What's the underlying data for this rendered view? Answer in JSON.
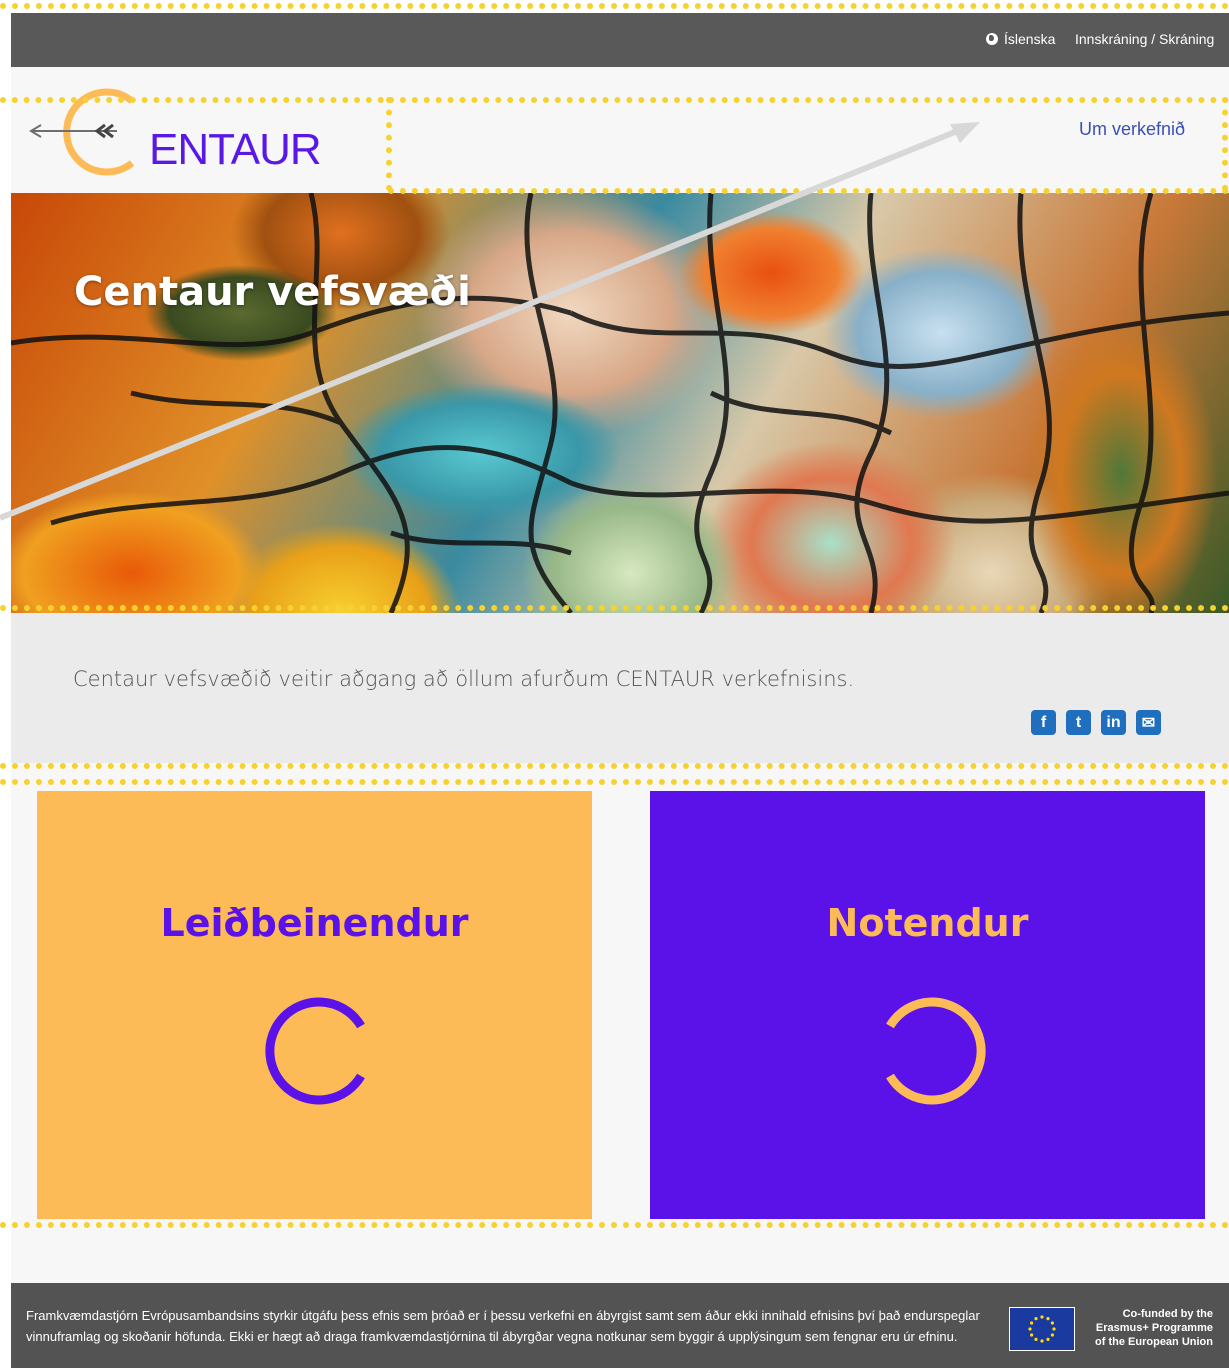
{
  "topbar": {
    "language_label": "Íslenska",
    "login_label": "Innskráning / Skráning"
  },
  "header": {
    "logo_text": "ENTAUR",
    "nav_about": "Um verkefnið"
  },
  "hero": {
    "title": "Centaur vefsvæði"
  },
  "intro": {
    "text": "Centaur vefsvæðið veitir aðgang að öllum afurðum CENTAUR verkefnisins.",
    "social": [
      {
        "icon": "facebook-icon",
        "glyph": "f"
      },
      {
        "icon": "twitter-icon",
        "glyph": "t"
      },
      {
        "icon": "linkedin-icon",
        "glyph": "in"
      },
      {
        "icon": "email-icon",
        "glyph": "✉"
      }
    ]
  },
  "cards": [
    {
      "title": "Leiðbeinendur",
      "background": "#fdbb58",
      "accent": "#5a12e8"
    },
    {
      "title": "Notendur",
      "background": "#5a12e8",
      "accent": "#fdbb58"
    }
  ],
  "footer": {
    "disclaimer": "Framkvæmdastjórn Evrópusambandsins styrkir útgáfu þess efnis sem þróað er í þessu verkefni en ábyrgist samt sem áður ekki innihald efnisins því það endurspeglar vinnuframlag og skoðanir höfunda. Ekki er hægt að draga framkvæmdastjórnina til ábyrgðar vegna notkunar sem byggir á upplýsingum sem fengnar eru úr efninu.",
    "eu_line1": "Co-funded by the",
    "eu_line2": "Erasmus+ Programme",
    "eu_line3": "of the European Union"
  },
  "colors": {
    "brand_purple": "#5a12e8",
    "brand_orange": "#fdbb58",
    "topbar": "#595959",
    "footer": "#535353",
    "annotation_dots": "#f5d230"
  }
}
